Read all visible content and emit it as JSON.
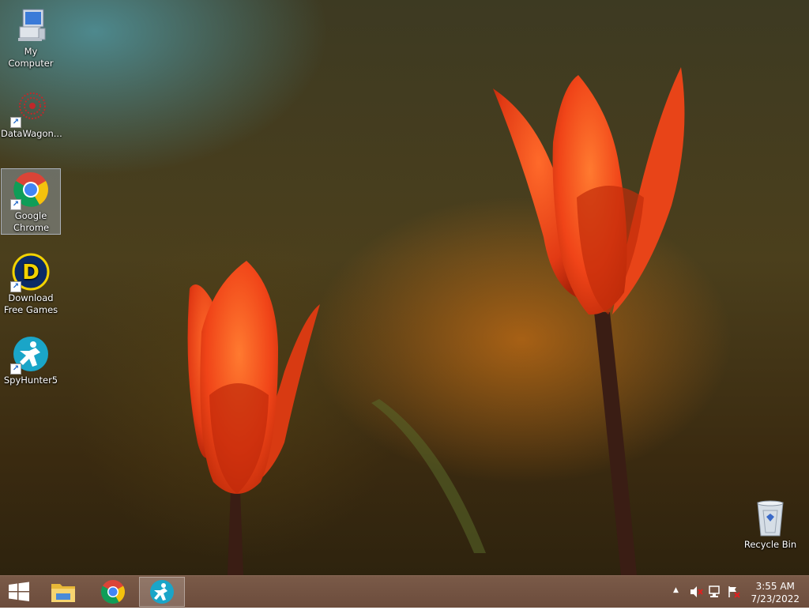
{
  "desktop": {
    "icons": [
      {
        "label": "My Computer",
        "icon": "computer-icon"
      },
      {
        "label": "DataWagon...",
        "icon": "datawagon-icon"
      },
      {
        "label": "Google Chrome",
        "icon": "chrome-icon"
      },
      {
        "label": "Download Free Games",
        "icon": "download-free-games-icon"
      },
      {
        "label": "SpyHunter5",
        "icon": "spyhunter-icon"
      }
    ],
    "recycle_bin": {
      "label": "Recycle Bin",
      "icon": "recycle-bin-icon"
    }
  },
  "taskbar": {
    "start_icon": "windows-logo-icon",
    "pinned": [
      {
        "icon": "file-explorer-icon"
      },
      {
        "icon": "chrome-icon"
      },
      {
        "icon": "spyhunter-icon",
        "active": true
      }
    ],
    "tray": {
      "icons": [
        "show-hidden-icons-chevron",
        "speaker-muted-icon",
        "network-icon",
        "action-center-flag-icon"
      ]
    },
    "clock": {
      "time": "3:55 AM",
      "date": "7/23/2022"
    }
  },
  "colors": {
    "taskbar": "#6c4c3c",
    "tulip": "#f04a18",
    "spyhunter": "#1aa5c8"
  }
}
